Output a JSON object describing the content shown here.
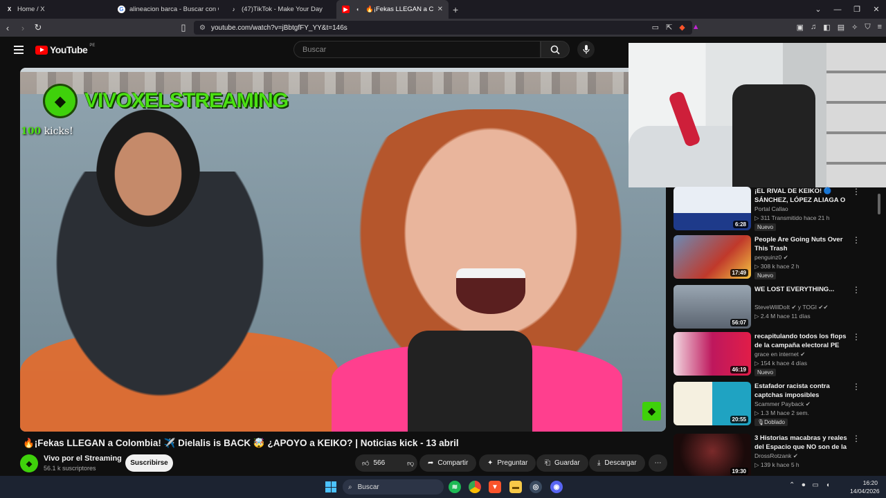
{
  "browser": {
    "tabs": [
      {
        "label": "Home / X",
        "icon": "X"
      },
      {
        "label": "alineacion barca - Buscar con Google",
        "icon": "G"
      },
      {
        "label": "(47)TikTok - Make Your Day",
        "icon": "♪"
      },
      {
        "label": "🔥¡Fekas LLEGAN a Colombia",
        "icon": "▶",
        "active": true
      }
    ],
    "url": "youtube.com/watch?v=jBbtgfFY_YY&t=146s"
  },
  "youtube": {
    "logo_word": "YouTube",
    "country_code": "PE",
    "search_placeholder": "Buscar"
  },
  "video": {
    "overlay_brand": "VIVOXELSTREAMING",
    "overlay_kicks_num": "100",
    "overlay_kicks_label": "kicks!",
    "title": "🔥¡Fekas LLEGAN a Colombia! ✈️ Dielalis is BACK 🤯 ¿APOYO a KEIKO? | Noticias kick - 13 abril",
    "channel_name": "Vivo por el Streaming",
    "subscribers": "56.1 k suscriptores",
    "subscribe_label": "Suscribirse",
    "likes": "566",
    "share_label": "Compartir",
    "ask_label": "Preguntar",
    "save_label": "Guardar",
    "download_label": "Descargar"
  },
  "recommendations": [
    {
      "title": "¡EL RIVAL DE KEIKO! 🔵 SÁNCHEZ, LÓPEZ ALIAGA O ...",
      "channel": "Portal Callao",
      "meta": "▷ 311  Transmitido hace 21 h",
      "duration": "6:28",
      "badge": "Nuevo",
      "thumb_color": "#1e3a8a"
    },
    {
      "title": "People Are Going Nuts Over This Trash",
      "channel": "penguinz0 ✔",
      "meta": "▷ 308 k  hace 2 h",
      "duration": "17:49",
      "badge": "Nuevo",
      "thumb_color": "#7c3a2d"
    },
    {
      "title": "WE LOST EVERYTHING...",
      "channel": "SteveWillDoIt ✔ y TOGI ✔✔",
      "meta": "▷ 2.4 M  hace 11 días",
      "duration": "56:07",
      "badge": "",
      "thumb_color": "#6b7280"
    },
    {
      "title": "recapitulando todos los flops de la campaña electoral PE",
      "channel": "grace en internet ✔",
      "meta": "▷ 154 k  hace 4 días",
      "duration": "46:19",
      "badge": "Nuevo",
      "thumb_color": "#be185d"
    },
    {
      "title": "Estafador racista contra captchas imposibles",
      "channel": "Scammer Payback ✔",
      "meta": "▷ 1.3 M  hace 2 sem.",
      "duration": "20:55",
      "badge": "🎙Doblado",
      "thumb_color": "#0e7490"
    },
    {
      "title": "3 Historias macabras y reales del Espacio que NO son de la ...",
      "channel": "DrossRotzank ✔",
      "meta": "▷ 139 k  hace 5 h",
      "duration": "19:30",
      "badge": "",
      "thumb_color": "#3f1d1d"
    }
  ],
  "taskbar": {
    "search_label": "Buscar",
    "time": "16:20",
    "date": "14/04/2026",
    "apps": [
      {
        "name": "spotify",
        "color": "#1db954",
        "glyph": "≋"
      },
      {
        "name": "chrome",
        "color": "#ea4335",
        "glyph": "●"
      },
      {
        "name": "brave",
        "color": "#fb542b",
        "glyph": "▼"
      },
      {
        "name": "explorer",
        "color": "#f7c948",
        "glyph": "▬"
      },
      {
        "name": "steam",
        "color": "#3a4a5f",
        "glyph": "◎"
      },
      {
        "name": "discord",
        "color": "#5865f2",
        "glyph": "◉"
      }
    ]
  }
}
